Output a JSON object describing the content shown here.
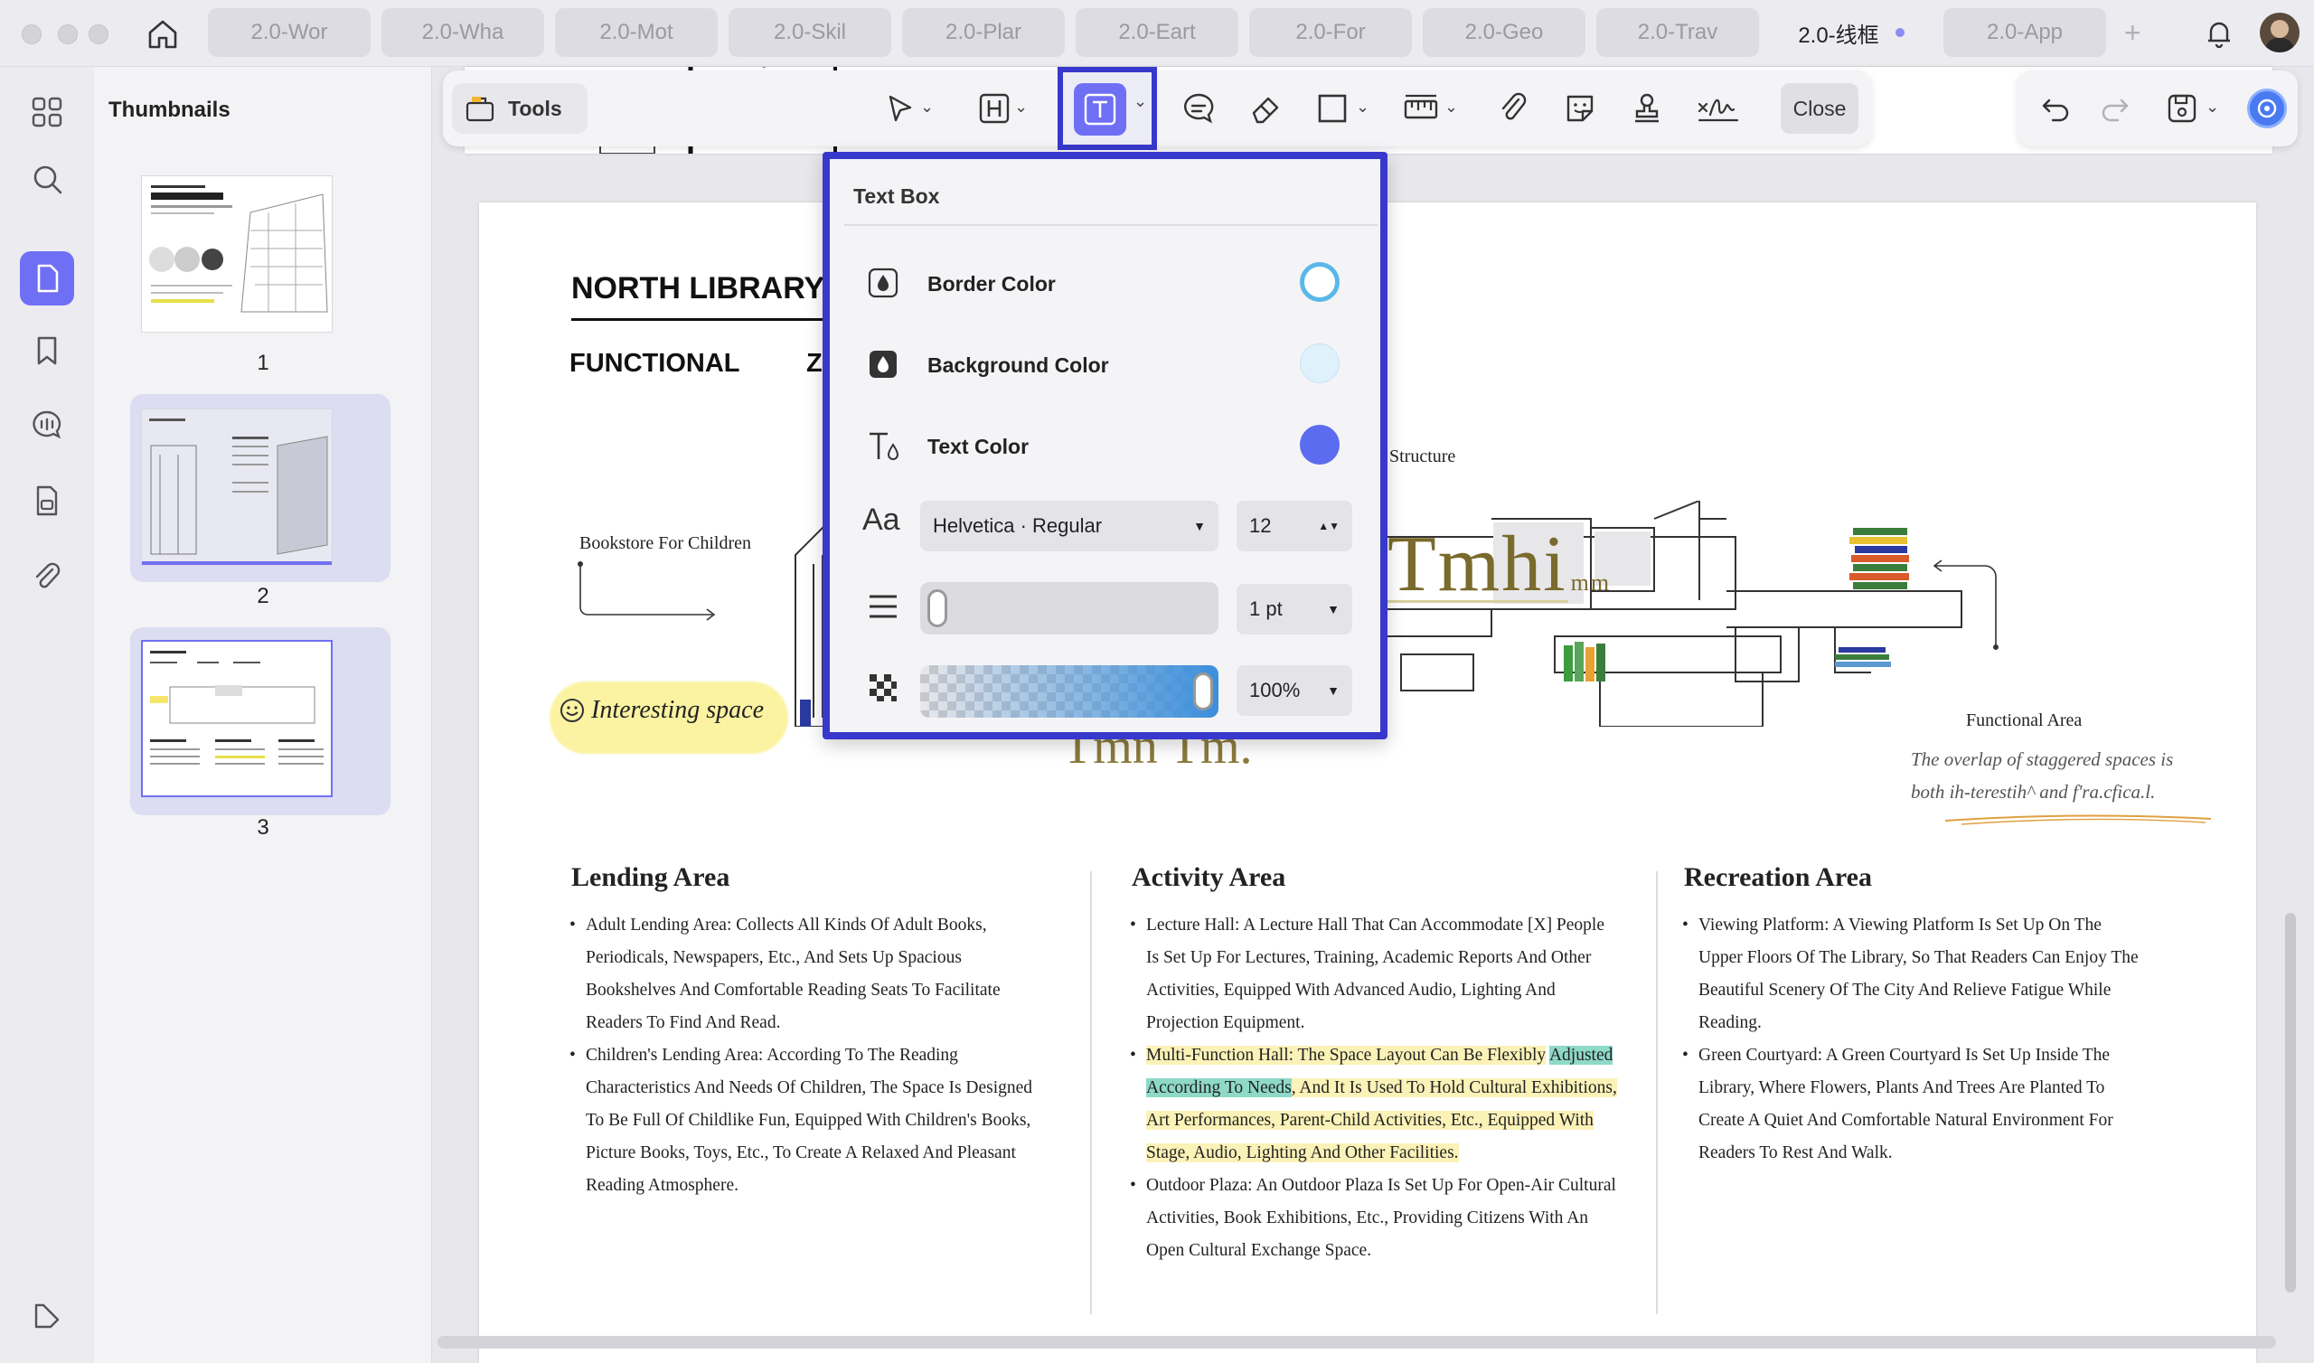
{
  "tabs": [
    "2.0-Wor",
    "2.0-Wha",
    "2.0-Mot",
    "2.0-Skil",
    "2.0-Plar",
    "2.0-Eart",
    "2.0-For",
    "2.0-Geo",
    "2.0-Trav",
    "2.0-线框",
    "2.0-App"
  ],
  "active_tab_index": 9,
  "sidebar": {
    "title": "Thumbnails",
    "pages": [
      "1",
      "2",
      "3"
    ]
  },
  "toolbar": {
    "tools_label": "Tools",
    "close_label": "Close"
  },
  "popup": {
    "title": "Text Box",
    "border_color_label": "Border Color",
    "background_color_label": "Background Color",
    "text_color_label": "Text Color",
    "font_value": "Helvetica · Regular",
    "size_value": "12",
    "stroke_value": "1 pt",
    "opacity_value": "100%",
    "colors": {
      "border": "#5ab8e8",
      "background": "#dff1fb",
      "text": "#5b6cf0",
      "accent": "#6f6ff5"
    }
  },
  "document": {
    "header_title": "NORTH LIBRARY",
    "header_sub1": "FUNCTIONAL",
    "header_sub2": "Z",
    "structure_label": "Structure",
    "bookstore_label": "Bookstore For Children",
    "interesting_label": "Interesting space",
    "functional_label": "Functional Area",
    "handwritten_note_1": "The overlap of staggered spaces is",
    "handwritten_note_2": "both ih-terestih^ and f'ra.cfica.l.",
    "stamp_text_1": "Tmhi",
    "stamp_text_1_sub": "mm",
    "stamp_text_2": "Tmn Tm.",
    "lending": {
      "title": "Lending Area",
      "items": [
        "Adult Lending Area: Collects All Kinds Of Adult Books, Periodicals, Newspapers, Etc., And Sets Up Spacious Bookshelves And Comfortable Reading Seats To Facilitate Readers To Find And Read.",
        "Children's Lending Area: According To The Reading Characteristics And Needs Of Children, The Space Is Designed To Be Full Of Childlike Fun, Equipped With Children's Books, Picture Books, Toys, Etc., To Create A Relaxed And Pleasant Reading Atmosphere."
      ]
    },
    "activity": {
      "title": "Activity Area",
      "item1": "Lecture Hall: A Lecture Hall That Can Accommodate [X] People Is Set Up For Lectures, Training, Academic Reports And Other Activities, Equipped With Advanced Audio, Lighting And Projection Equipment.",
      "item2_hl_yellow": "Multi-Function Hall: The Space Layout Can Be Flexibly",
      "item2_hl_green": "Adjusted According To Needs",
      "item2_rest": ", And It Is Used To Hold Cultural Exhibitions, Art Performances, Parent-Child Activities, Etc., Equipped With Stage, Audio, Lighting And Other Facilities.",
      "item3": "Outdoor Plaza: An Outdoor Plaza Is Set Up For Open-Air Cultural Activities, Book Exhibitions, Etc., Providing Citizens With An Open Cultural Exchange Space."
    },
    "recreation": {
      "title": "Recreation Area",
      "items": [
        "Viewing Platform: A Viewing Platform Is Set Up On The Upper Floors Of The Library, So That Readers Can Enjoy The Beautiful Scenery Of The City And Relieve Fatigue While Reading.",
        "Green Courtyard: A Green Courtyard Is Set Up Inside The Library, Where Flowers, Plants And Trees Are Planted To Create A Quiet And Comfortable Natural Environment For Readers To Rest And Walk."
      ]
    }
  }
}
